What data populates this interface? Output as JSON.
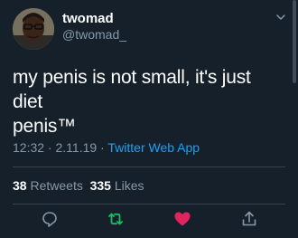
{
  "author": {
    "display_name": "twomad",
    "handle": "@twomad_",
    "avatar_icon": "user-avatar"
  },
  "tweet": {
    "text_line1": "my penis is not small, it's just diet",
    "text_line2": "penis™"
  },
  "meta": {
    "time": "12:32",
    "separator1": " · ",
    "date": "2.11.19",
    "separator2": " · ",
    "source": "Twitter Web App"
  },
  "stats": {
    "retweets_count": "38",
    "retweets_label": "Retweets",
    "likes_count": "335",
    "likes_label": "Likes"
  },
  "actions": {
    "reply_icon": "reply-icon",
    "retweet_icon": "retweet-icon",
    "like_icon": "heart-icon",
    "share_icon": "share-icon"
  },
  "colors": {
    "background": "#15202b",
    "secondary_text": "#8899a6",
    "link": "#1da1f2",
    "retweet_active": "#17bf63",
    "like_active": "#e0245e",
    "divider": "#38444d"
  }
}
